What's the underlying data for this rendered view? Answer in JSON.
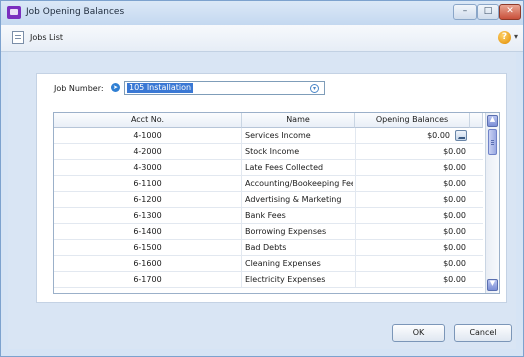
{
  "window": {
    "title": "Job Opening Balances"
  },
  "toolbar": {
    "jobs_list_label": "Jobs List",
    "help_icon": "help-icon"
  },
  "form": {
    "job_number_label": "Job Number:",
    "job_number_value": "105 Installation"
  },
  "grid": {
    "columns": [
      "Acct No.",
      "Name",
      "Opening Balances"
    ],
    "rows": [
      {
        "acct": "4-1000",
        "name": "Services Income",
        "balance": "$0.00"
      },
      {
        "acct": "4-2000",
        "name": "Stock Income",
        "balance": "$0.00"
      },
      {
        "acct": "4-3000",
        "name": "Late Fees Collected",
        "balance": "$0.00"
      },
      {
        "acct": "6-1100",
        "name": "Accounting/Bookeeping Fees",
        "balance": "$0.00"
      },
      {
        "acct": "6-1200",
        "name": "Advertising & Marketing",
        "balance": "$0.00"
      },
      {
        "acct": "6-1300",
        "name": "Bank Fees",
        "balance": "$0.00"
      },
      {
        "acct": "6-1400",
        "name": "Borrowing Expenses",
        "balance": "$0.00"
      },
      {
        "acct": "6-1500",
        "name": "Bad Debts",
        "balance": "$0.00"
      },
      {
        "acct": "6-1600",
        "name": "Cleaning Expenses",
        "balance": "$0.00"
      },
      {
        "acct": "6-1700",
        "name": "Electricity Expenses",
        "balance": "$0.00"
      }
    ]
  },
  "buttons": {
    "ok": "OK",
    "cancel": "Cancel"
  }
}
